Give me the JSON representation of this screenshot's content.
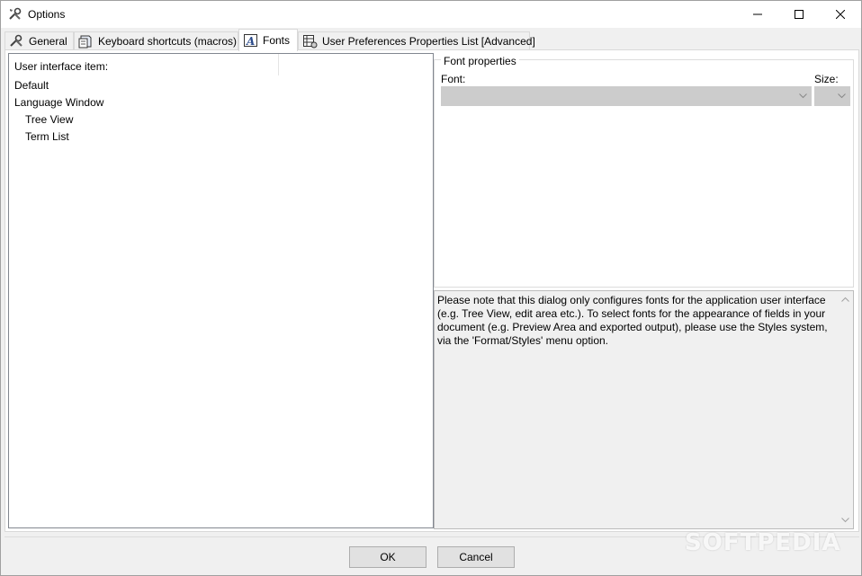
{
  "window": {
    "title": "Options",
    "app_icon": "tools-icon",
    "controls": [
      "minimize-icon",
      "maximize-icon",
      "close-icon"
    ]
  },
  "tabs": [
    {
      "label": "General",
      "icon": "tools-icon",
      "active": false
    },
    {
      "label": "Keyboard shortcuts (macros)",
      "icon": "keyboard-icon",
      "active": false
    },
    {
      "label": "Fonts",
      "icon": "font-icon",
      "active": true
    },
    {
      "label": "User Preferences Properties List [Advanced]",
      "icon": "property-list-icon",
      "active": false
    }
  ],
  "left_panel": {
    "header": "User interface item:",
    "items": [
      {
        "label": "Default",
        "level": 0
      },
      {
        "label": "Language Window",
        "level": 0
      },
      {
        "label": "Tree View",
        "level": 1
      },
      {
        "label": "Term List",
        "level": 1
      }
    ]
  },
  "font_properties": {
    "group_title": "Font properties",
    "font_label": "Font:",
    "size_label": "Size:",
    "font_value": "",
    "size_value": ""
  },
  "note": "Please note that this dialog only configures fonts for the application user interface (e.g. Tree View, edit area etc.). To select fonts for the appearance of fields in your document (e.g. Preview Area and exported output), please use the Styles system, via the 'Format/Styles' menu option.",
  "buttons": {
    "ok": "OK",
    "cancel": "Cancel"
  },
  "watermark": "SOFTPEDIA"
}
